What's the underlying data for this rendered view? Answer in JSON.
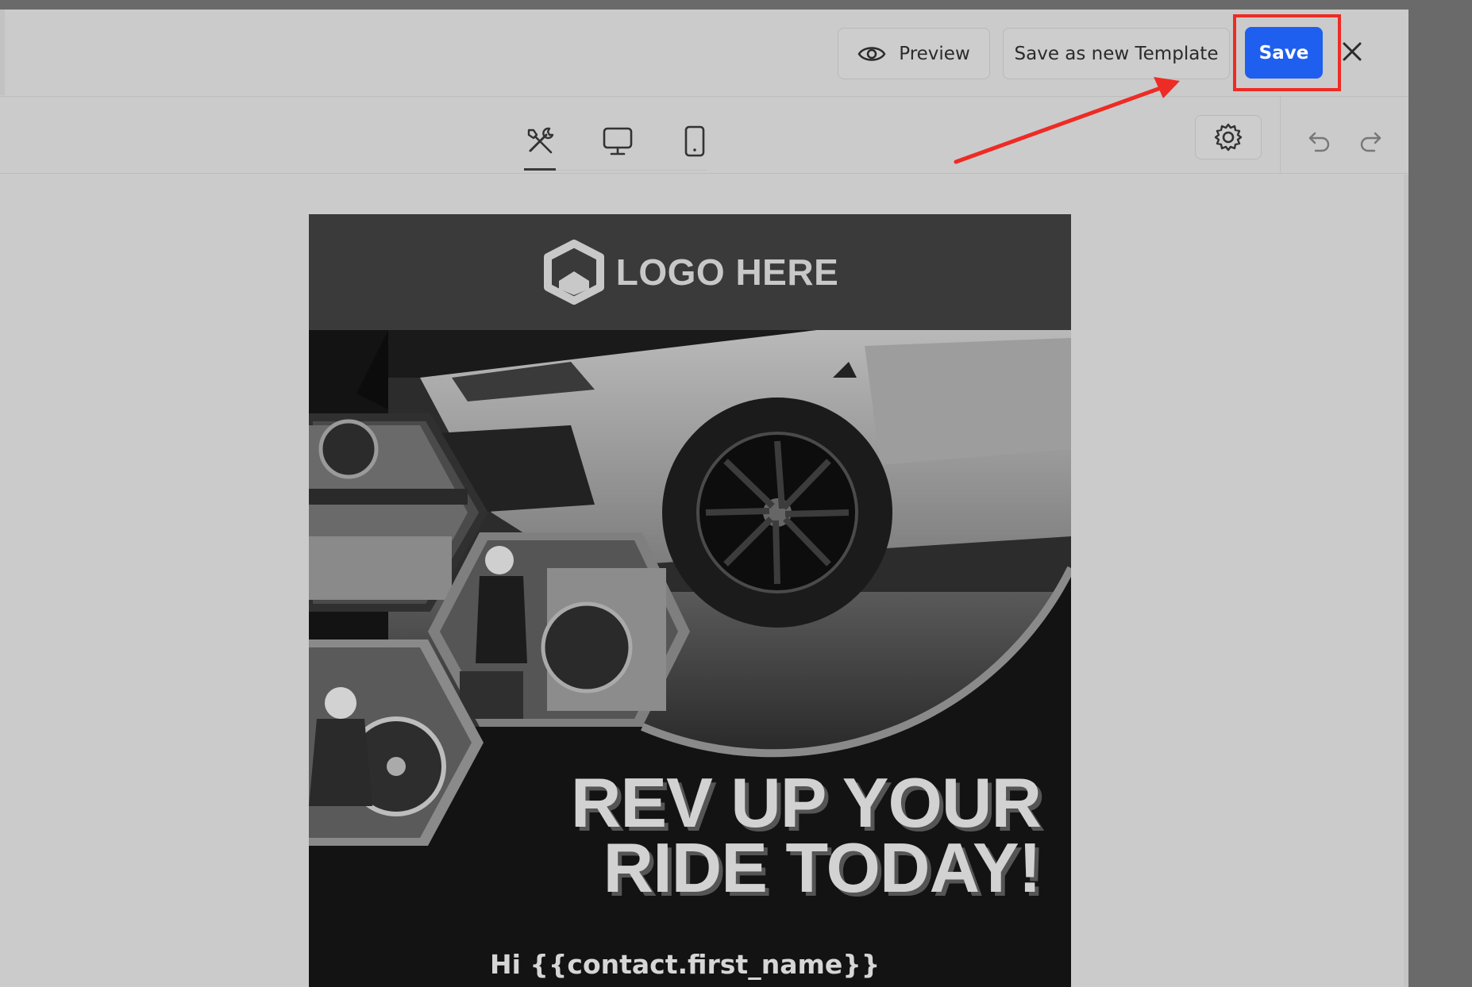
{
  "topbar": {
    "preview_label": "Preview",
    "save_template_label": "Save as new Template",
    "save_label": "Save",
    "close_icon": "close-icon",
    "preview_icon": "eye-icon"
  },
  "toolbar": {
    "view_tabs": [
      {
        "name": "edit",
        "icon": "tools-icon",
        "active": true
      },
      {
        "name": "desktop",
        "icon": "monitor-icon",
        "active": false
      },
      {
        "name": "mobile",
        "icon": "phone-icon",
        "active": false
      }
    ],
    "settings_icon": "gear-icon",
    "undo_icon": "undo-icon",
    "redo_icon": "redo-icon"
  },
  "email": {
    "logo_text": "LOGO HERE",
    "headline_line1": "REV UP YOUR",
    "headline_line2": "RIDE TODAY!",
    "greeting": "Hi {{contact.first_name}}"
  },
  "colors": {
    "save_button": "#1f5ff0",
    "highlight": "#ee2b24",
    "annotation_arrow": "#ee2b24"
  }
}
